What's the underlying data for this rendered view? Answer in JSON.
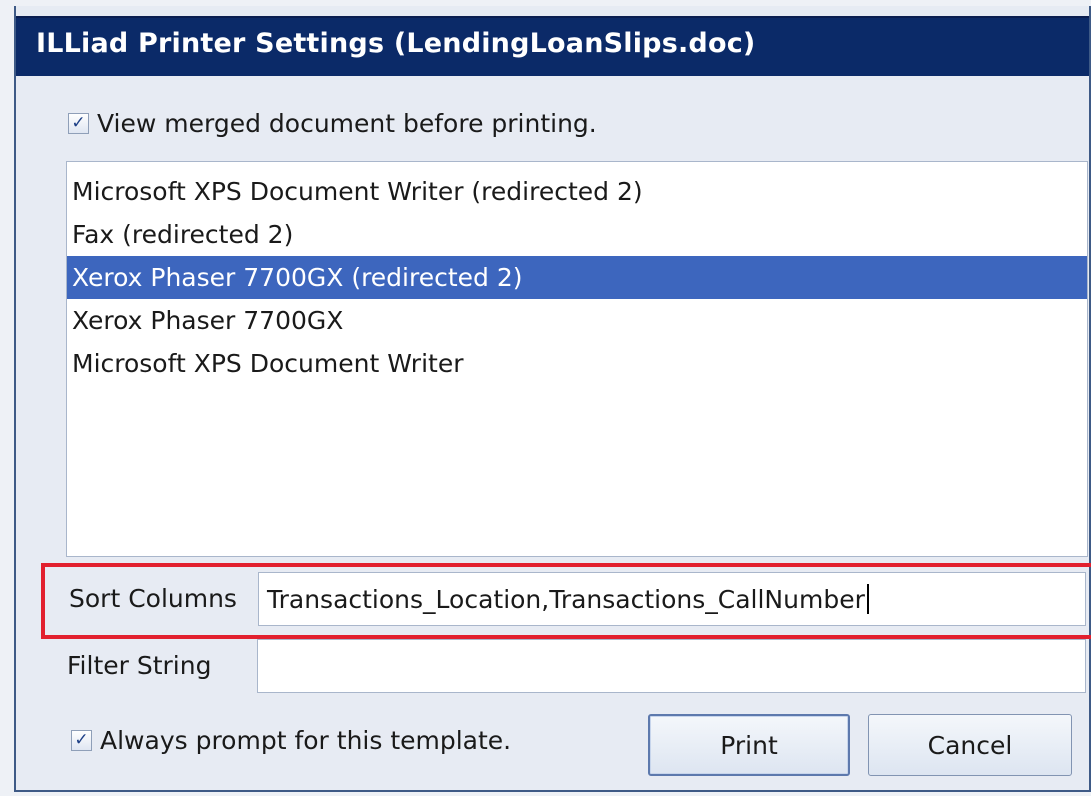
{
  "window": {
    "title": "ILLiad Printer Settings (LendingLoanSlips.doc)"
  },
  "options": {
    "view_merged": {
      "label": "View merged document before printing.",
      "checked": true
    },
    "always_prompt": {
      "label": "Always prompt for this template.",
      "checked": true
    }
  },
  "printers": {
    "items": [
      {
        "label": "Microsoft XPS Document Writer (redirected 2)"
      },
      {
        "label": "Fax (redirected 2)"
      },
      {
        "label": "Xerox Phaser 7700GX (redirected 2)"
      },
      {
        "label": "Xerox Phaser 7700GX"
      },
      {
        "label": "Microsoft XPS Document Writer"
      }
    ],
    "selected": "Xerox Phaser 7700GX (redirected 2)"
  },
  "sort": {
    "label": "Sort Columns",
    "value": "Transactions_Location,Transactions_CallNumber"
  },
  "filter": {
    "label": "Filter String",
    "value": ""
  },
  "buttons": {
    "print": "Print",
    "cancel": "Cancel"
  },
  "colors": {
    "titlebar": "#0b2a68",
    "selection": "#3d66be",
    "highlight": "#e2202e"
  },
  "icons": {
    "checkbox_checked": "check-icon"
  }
}
